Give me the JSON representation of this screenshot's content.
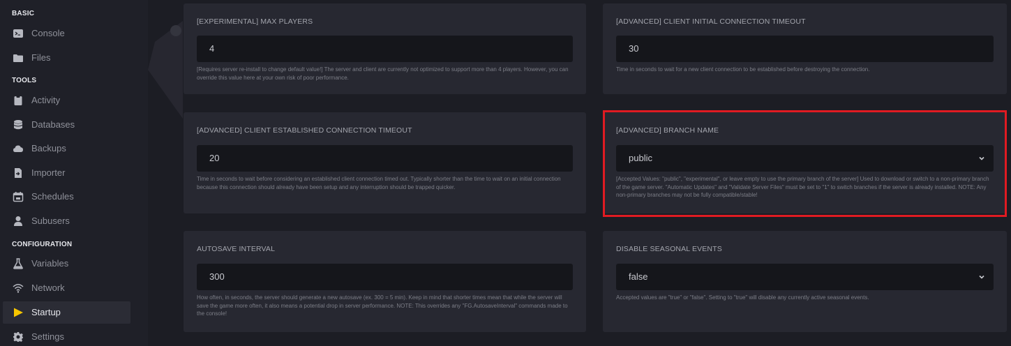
{
  "sidebar": {
    "sections": [
      "BASIC",
      "TOOLS",
      "CONFIGURATION"
    ],
    "items": [
      {
        "label": "Console",
        "icon": "terminal-icon"
      },
      {
        "label": "Files",
        "icon": "folder-icon"
      },
      {
        "label": "Activity",
        "icon": "clipboard-icon"
      },
      {
        "label": "Databases",
        "icon": "database-icon"
      },
      {
        "label": "Backups",
        "icon": "cloud-icon"
      },
      {
        "label": "Importer",
        "icon": "file-import-icon"
      },
      {
        "label": "Schedules",
        "icon": "calendar-icon"
      },
      {
        "label": "Subusers",
        "icon": "user-icon"
      },
      {
        "label": "Variables",
        "icon": "flask-icon"
      },
      {
        "label": "Network",
        "icon": "wifi-icon"
      },
      {
        "label": "Startup",
        "icon": "play-icon"
      },
      {
        "label": "Settings",
        "icon": "gear-icon"
      }
    ],
    "active": "Startup"
  },
  "variables": [
    {
      "title": "[EXPERIMENTAL] MAX PLAYERS",
      "value": "4",
      "type": "text",
      "description": "[Requires server re-install to change default value!] The server and client are currently not optimized to support more than 4 players. However, you can override this value here at your own risk of poor performance."
    },
    {
      "title": "[ADVANCED] CLIENT INITIAL CONNECTION TIMEOUT",
      "value": "30",
      "type": "text",
      "description": "Time in seconds to wait for a new client connection to be established before destroying the connection."
    },
    {
      "title": "[ADVANCED] CLIENT ESTABLISHED CONNECTION TIMEOUT",
      "value": "20",
      "type": "text",
      "description": "Time in seconds to wait before considering an established client connection timed out. Typically shorter than the time to wait on an initial connection because this connection should already have been setup and any interruption should be trapped quicker."
    },
    {
      "title": "[ADVANCED] BRANCH NAME",
      "value": "public",
      "type": "select",
      "description": "[Accepted Values: \"public\", \"experimental\", or leave empty to use the primary branch of the server] Used to download or switch to a non-primary branch of the game server. \"Automatic Updates\" and \"Validate Server Files\" must be set to \"1\" to switch branches if the server is already installed. NOTE: Any non-primary branches may not be fully compatible/stable!"
    },
    {
      "title": "AUTOSAVE INTERVAL",
      "value": "300",
      "type": "text",
      "description": "How often, in seconds, the server should generate a new autosave (ex. 300 = 5 min). Keep in mind that shorter times mean that while the server will save the game more often, it also means a potential drop in server performance. NOTE: This overrides any \"FG.AutosaveInterval\" commands made to the console!"
    },
    {
      "title": "DISABLE SEASONAL EVENTS",
      "value": "false",
      "type": "select",
      "description": "Accepted values are \"true\" or \"false\". Setting to \"true\" will disable any currently active seasonal events."
    }
  ],
  "colors": {
    "highlight": "#e01b22",
    "accent": "#f7c600"
  }
}
